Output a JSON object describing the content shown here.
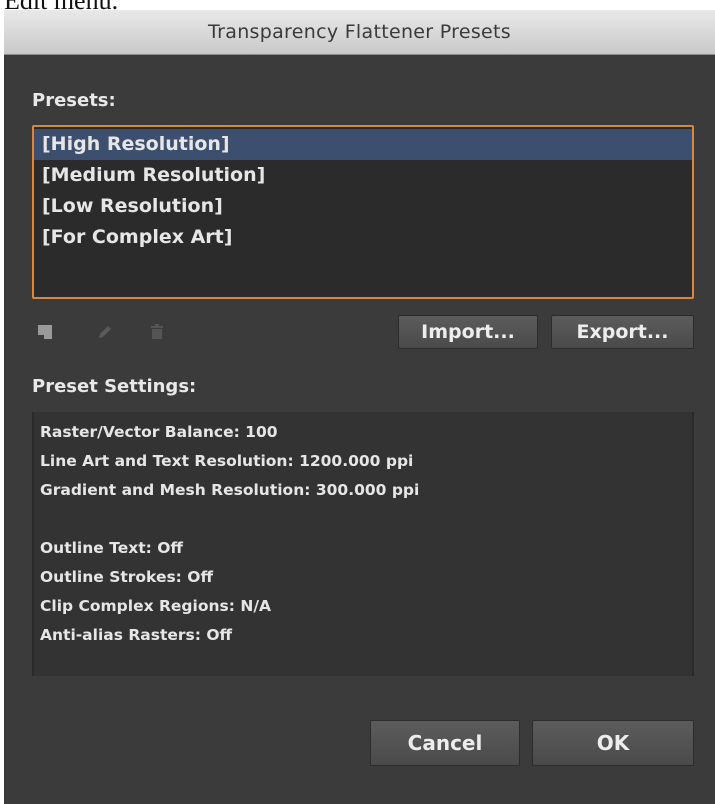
{
  "clipped_heading": "Edit menu.",
  "dialog": {
    "title": "Transparency Flattener Presets"
  },
  "presets": {
    "label": "Presets:",
    "items": [
      {
        "label": "[High Resolution]",
        "selected": true
      },
      {
        "label": "[Medium Resolution]",
        "selected": false
      },
      {
        "label": "[Low Resolution]",
        "selected": false
      },
      {
        "label": "[For Complex Art]",
        "selected": false
      }
    ]
  },
  "toolbar": {
    "icons": [
      "new-preset-icon",
      "edit-pencil-icon",
      "trash-icon"
    ],
    "import_label": "Import...",
    "export_label": "Export..."
  },
  "preset_settings": {
    "label": "Preset Settings:",
    "lines_group1": [
      "Raster/Vector Balance: 100",
      "Line Art and Text Resolution: 1200.000 ppi",
      "Gradient and Mesh Resolution: 300.000 ppi"
    ],
    "lines_group2": [
      "Outline Text: Off",
      "Outline Strokes: Off",
      "Clip Complex Regions: N/A",
      "Anti-alias Rasters: Off"
    ]
  },
  "footer": {
    "cancel_label": "Cancel",
    "ok_label": "OK"
  },
  "colors": {
    "dialog_bg": "#3b3b3b",
    "focus_border": "#d8873c",
    "selection": "#3d4f6e"
  }
}
